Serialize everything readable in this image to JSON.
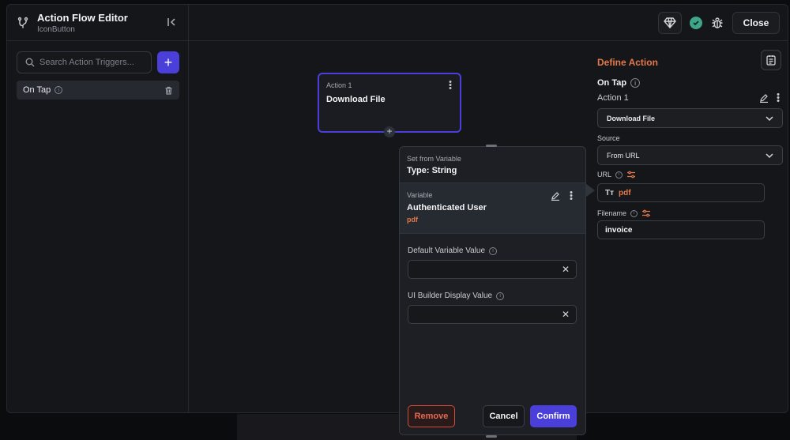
{
  "header": {
    "title": "Action Flow Editor",
    "subtitle": "IconButton",
    "close_label": "Close"
  },
  "sidebar": {
    "search_placeholder": "Search Action Triggers...",
    "trigger_label": "On Tap"
  },
  "canvas": {
    "node": {
      "small": "Action 1",
      "title": "Download File"
    }
  },
  "variable_panel": {
    "set_from_label": "Set from Variable",
    "type_label": "Type: String",
    "variable_small": "Variable",
    "variable_name": "Authenticated User",
    "variable_field": "pdf",
    "default_value_label": "Default Variable Value",
    "ui_builder_label": "UI Builder Display Value",
    "remove_label": "Remove",
    "cancel_label": "Cancel",
    "confirm_label": "Confirm"
  },
  "define_action": {
    "title": "Define Action",
    "trigger": "On Tap",
    "action_name": "Action 1",
    "action_type": "Download File",
    "source_label": "Source",
    "source_value": "From URL",
    "url_label": "URL",
    "url_value": "pdf",
    "url_type_icon": "Tт",
    "filename_label": "Filename",
    "filename_value": "invoice"
  },
  "colors": {
    "accent": "#4a3fd9",
    "orange": "#e5784a",
    "success": "#3fa58b",
    "danger": "#d34b3a"
  }
}
